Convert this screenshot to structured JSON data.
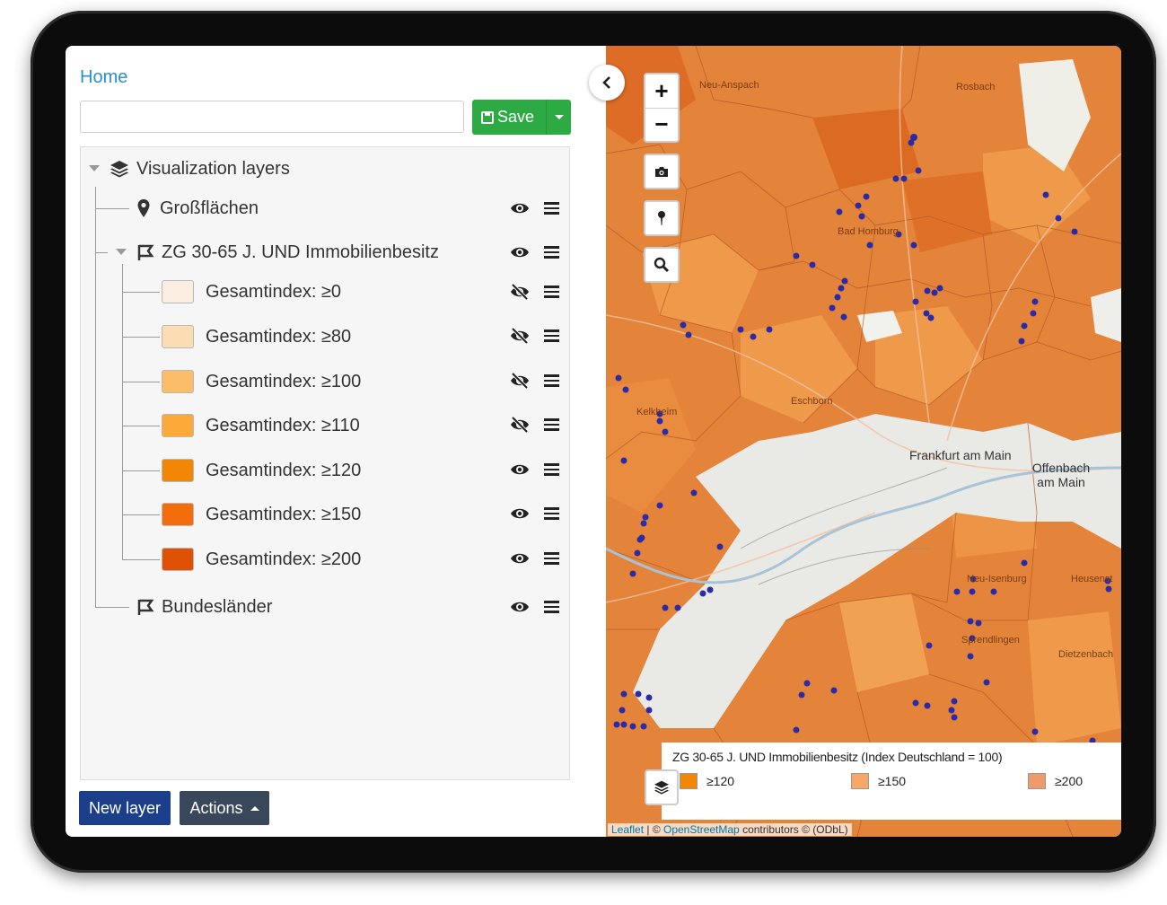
{
  "header": {
    "home_link": "Home",
    "layer_name_value": "",
    "save_label": "Save"
  },
  "tree": {
    "root_label": "Visualization layers",
    "layers": [
      {
        "label": "Großflächen",
        "visible": true
      },
      {
        "label": "ZG 30-65 J. UND Immobilienbesitz",
        "visible": true,
        "classes": [
          {
            "label": "Gesamtindex: ≥0",
            "color": "#fbeee1",
            "visible": false
          },
          {
            "label": "Gesamtindex: ≥80",
            "color": "#fcdcb3",
            "visible": false
          },
          {
            "label": "Gesamtindex: ≥100",
            "color": "#fbbd68",
            "visible": false
          },
          {
            "label": "Gesamtindex: ≥110",
            "color": "#fba939",
            "visible": false
          },
          {
            "label": "Gesamtindex: ≥120",
            "color": "#f28705",
            "visible": true
          },
          {
            "label": "Gesamtindex: ≥150",
            "color": "#f46d0d",
            "visible": true
          },
          {
            "label": "Gesamtindex: ≥200",
            "color": "#df5205",
            "visible": true
          }
        ]
      },
      {
        "label": "Bundesländer",
        "visible": true
      }
    ]
  },
  "footer": {
    "new_layer_label": "New layer",
    "actions_label": "Actions"
  },
  "map": {
    "zoom_in": "+",
    "zoom_out": "−",
    "labels": {
      "frankfurt": "Frankfurt am Main",
      "offenbach": "Offenbach am Main",
      "eschborn": "Eschborn",
      "neu_anspach": "Neu-Anspach",
      "rosbach": "Rosbach",
      "bad_homburg": "Bad Homburg",
      "kelkheim": "Kelkheim",
      "dietzenbach": "Dietzenbach",
      "sprendlingen": "Sprendlingen",
      "neu_isenburg": "Neu-Isenburg",
      "heusenstamm": "Heusenst"
    },
    "legend": {
      "title": "ZG 30-65 J. UND Immobilienbesitz (Index Deutschland = 100)",
      "items": [
        {
          "label": "≥120",
          "color": "#f28705"
        },
        {
          "label": "≥150",
          "color": "#f46d0d"
        },
        {
          "label": "≥200",
          "color": "#df5205"
        }
      ]
    },
    "attribution": {
      "leaflet": "Leaflet",
      "osm": "OpenStreetMap",
      "rest": "contributors © (ODbL)"
    },
    "colors": {
      "regions": "#e4833a",
      "regions_light": "#ee9a4a",
      "urban": "#e9e9e6",
      "points": "#2b2ba8"
    }
  }
}
